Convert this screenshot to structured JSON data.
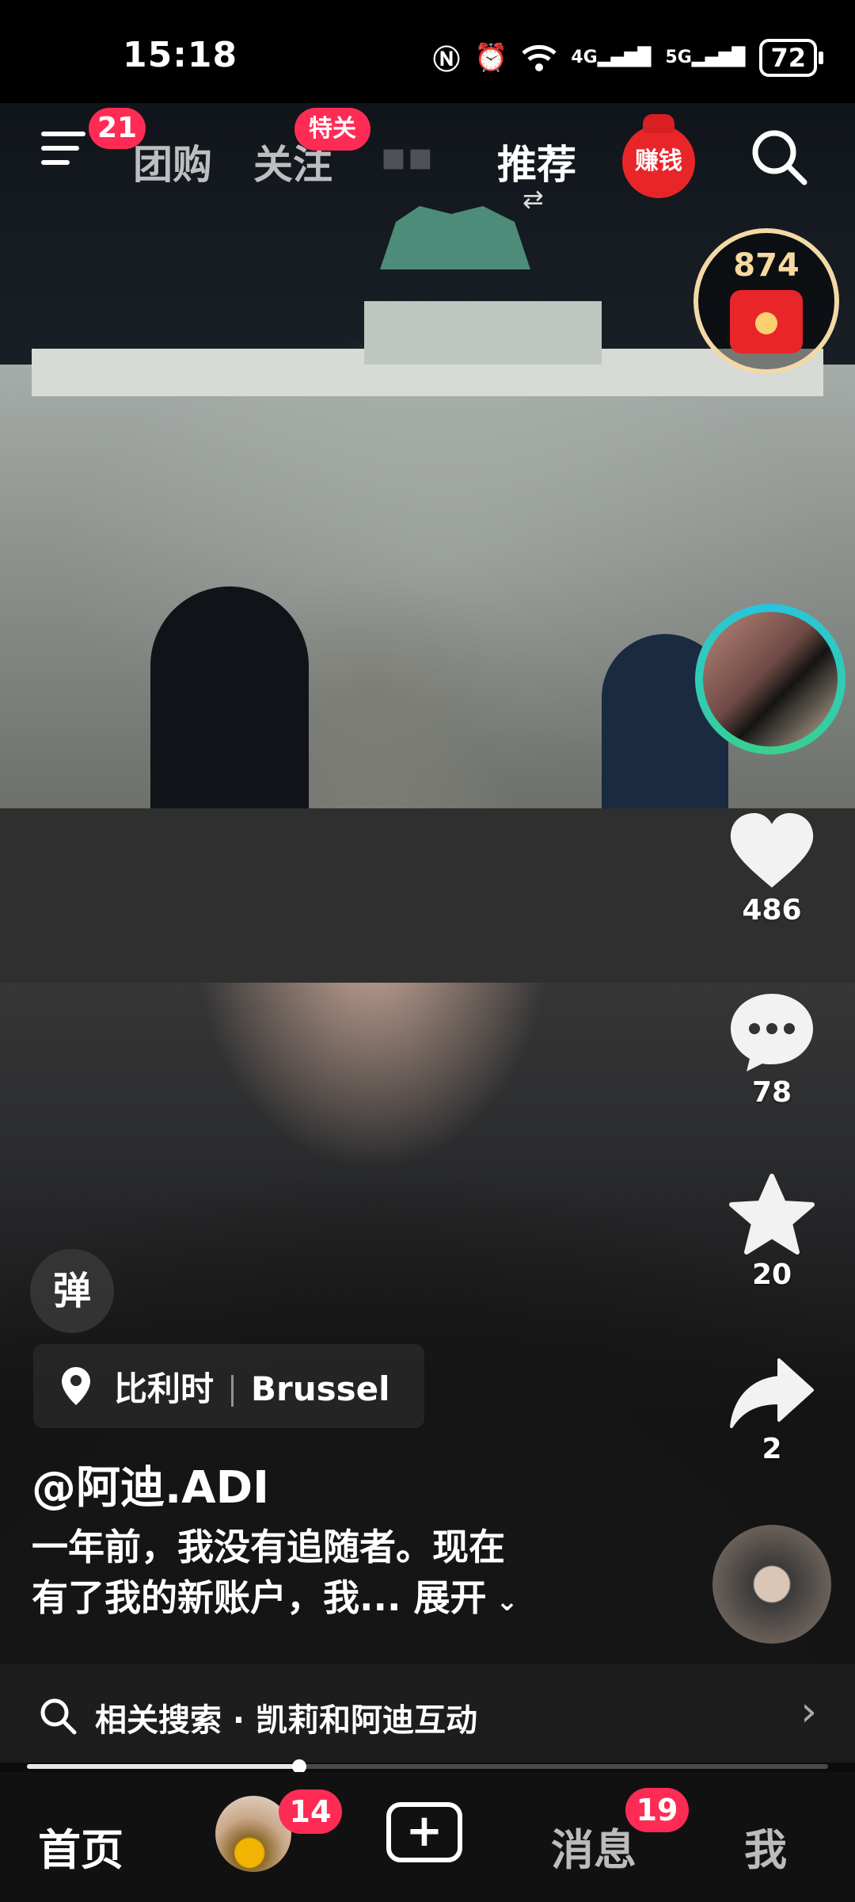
{
  "status_bar": {
    "time": "15:18",
    "icons": [
      "nfc-icon",
      "alarm-icon",
      "wifi-icon",
      "signal-4g-icon",
      "signal-5g-icon"
    ],
    "network_1": "4G",
    "network_2": "5G",
    "battery": "72"
  },
  "top_nav": {
    "menu_badge": "21",
    "tabs": [
      {
        "label": "团购"
      },
      {
        "label": "关注",
        "badge": "特关"
      },
      {
        "label": "推荐"
      }
    ],
    "active_tab": "推荐",
    "earn_label": "赚钱"
  },
  "coin_widget": {
    "count": "874"
  },
  "actions": {
    "likes": "486",
    "comments": "78",
    "favorites": "20",
    "shares": "2"
  },
  "info": {
    "danmu_label": "弹",
    "location_country": "比利时",
    "location_city": "Brussel",
    "username": "@阿迪.ADI",
    "caption_line1": "一年前，我没有追随者。现在",
    "caption_line2": "有了我的新账户，我... ",
    "expand_label": "展开"
  },
  "related_search": {
    "text": "相关搜索 · 凯莉和阿迪互动"
  },
  "progress": {
    "fraction": 0.34
  },
  "bottom_nav": {
    "home_label": "首页",
    "friends_badge": "14",
    "messages_label": "消息",
    "messages_badge": "19",
    "me_label": "我"
  },
  "colors": {
    "accent_red": "#fe2c55",
    "coin_gold": "#f7d9a0",
    "ring_teal": "#27c5e0"
  }
}
